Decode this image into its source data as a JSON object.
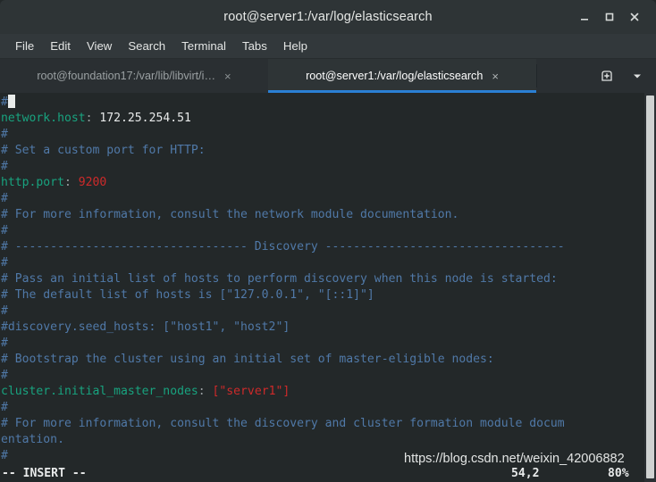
{
  "window": {
    "title": "root@server1:/var/log/elasticsearch",
    "buttons": [
      {
        "name": "minimize-button",
        "glyph": "minimize"
      },
      {
        "name": "maximize-button",
        "glyph": "maximize"
      },
      {
        "name": "close-button",
        "glyph": "close"
      }
    ]
  },
  "menubar": {
    "items": [
      {
        "label": "File"
      },
      {
        "label": "Edit"
      },
      {
        "label": "View"
      },
      {
        "label": "Search"
      },
      {
        "label": "Terminal"
      },
      {
        "label": "Tabs"
      },
      {
        "label": "Help"
      }
    ]
  },
  "tabbar": {
    "tabs": [
      {
        "label": "root@foundation17:/var/lib/libvirt/i…",
        "close": "×",
        "active": false
      },
      {
        "label": "root@server1:/var/log/elasticsearch",
        "close": "×",
        "active": true
      }
    ],
    "new_tab_icon": "new-tab-icon",
    "tab_list_icon": "chevron-down-icon"
  },
  "terminal": {
    "colors": {
      "background": "#232829",
      "comment": "#5079a8",
      "key": "#18a37f",
      "value": "#e8eaea",
      "number": "#cf2a2a",
      "string": "#cf2a2a",
      "cursor": "#e9ecea",
      "accent": "#2a7fd4"
    },
    "lines": [
      [
        {
          "t": "#",
          "c": "cmt"
        },
        {
          "t": "",
          "c": "cursor"
        }
      ],
      [
        {
          "t": "network.host",
          "c": "key"
        },
        {
          "t": ":",
          "c": "punc"
        },
        {
          "t": " 172.25.254.51",
          "c": "val"
        }
      ],
      [
        {
          "t": "#",
          "c": "cmt"
        }
      ],
      [
        {
          "t": "# Set a custom port for HTTP:",
          "c": "cmt"
        }
      ],
      [
        {
          "t": "#",
          "c": "cmt"
        }
      ],
      [
        {
          "t": "http.port",
          "c": "key"
        },
        {
          "t": ":",
          "c": "punc"
        },
        {
          "t": " ",
          "c": "val"
        },
        {
          "t": "9200",
          "c": "num"
        }
      ],
      [
        {
          "t": "#",
          "c": "cmt"
        }
      ],
      [
        {
          "t": "# For more information, consult the network module documentation.",
          "c": "cmt"
        }
      ],
      [
        {
          "t": "#",
          "c": "cmt"
        }
      ],
      [
        {
          "t": "# --------------------------------- Discovery ----------------------------------",
          "c": "cmt"
        }
      ],
      [
        {
          "t": "#",
          "c": "cmt"
        }
      ],
      [
        {
          "t": "# Pass an initial list of hosts to perform discovery when this node is started:",
          "c": "cmt"
        }
      ],
      [
        {
          "t": "# The default list of hosts is [\"127.0.0.1\", \"[::1]\"]",
          "c": "cmt"
        }
      ],
      [
        {
          "t": "#",
          "c": "cmt"
        }
      ],
      [
        {
          "t": "#discovery.seed_hosts: [\"host1\", \"host2\"]",
          "c": "cmt"
        }
      ],
      [
        {
          "t": "#",
          "c": "cmt"
        }
      ],
      [
        {
          "t": "# Bootstrap the cluster using an initial set of master-eligible nodes:",
          "c": "cmt"
        }
      ],
      [
        {
          "t": "#",
          "c": "cmt"
        }
      ],
      [
        {
          "t": "cluster.initial_master_nodes",
          "c": "key"
        },
        {
          "t": ":",
          "c": "punc"
        },
        {
          "t": " ",
          "c": "val"
        },
        {
          "t": "[\"server1\"]",
          "c": "str"
        }
      ],
      [
        {
          "t": "#",
          "c": "cmt"
        }
      ],
      [
        {
          "t": "# For more information, consult the discovery and cluster formation module docum",
          "c": "cmt"
        }
      ],
      [
        {
          "t": "entation.",
          "c": "cmt"
        }
      ],
      [
        {
          "t": "#",
          "c": "cmt"
        }
      ]
    ],
    "status": {
      "mode": "-- INSERT --",
      "position": "54,2",
      "percent": "80%"
    }
  },
  "watermark": {
    "text": "https://blog.csdn.net/weixin_42006882"
  }
}
